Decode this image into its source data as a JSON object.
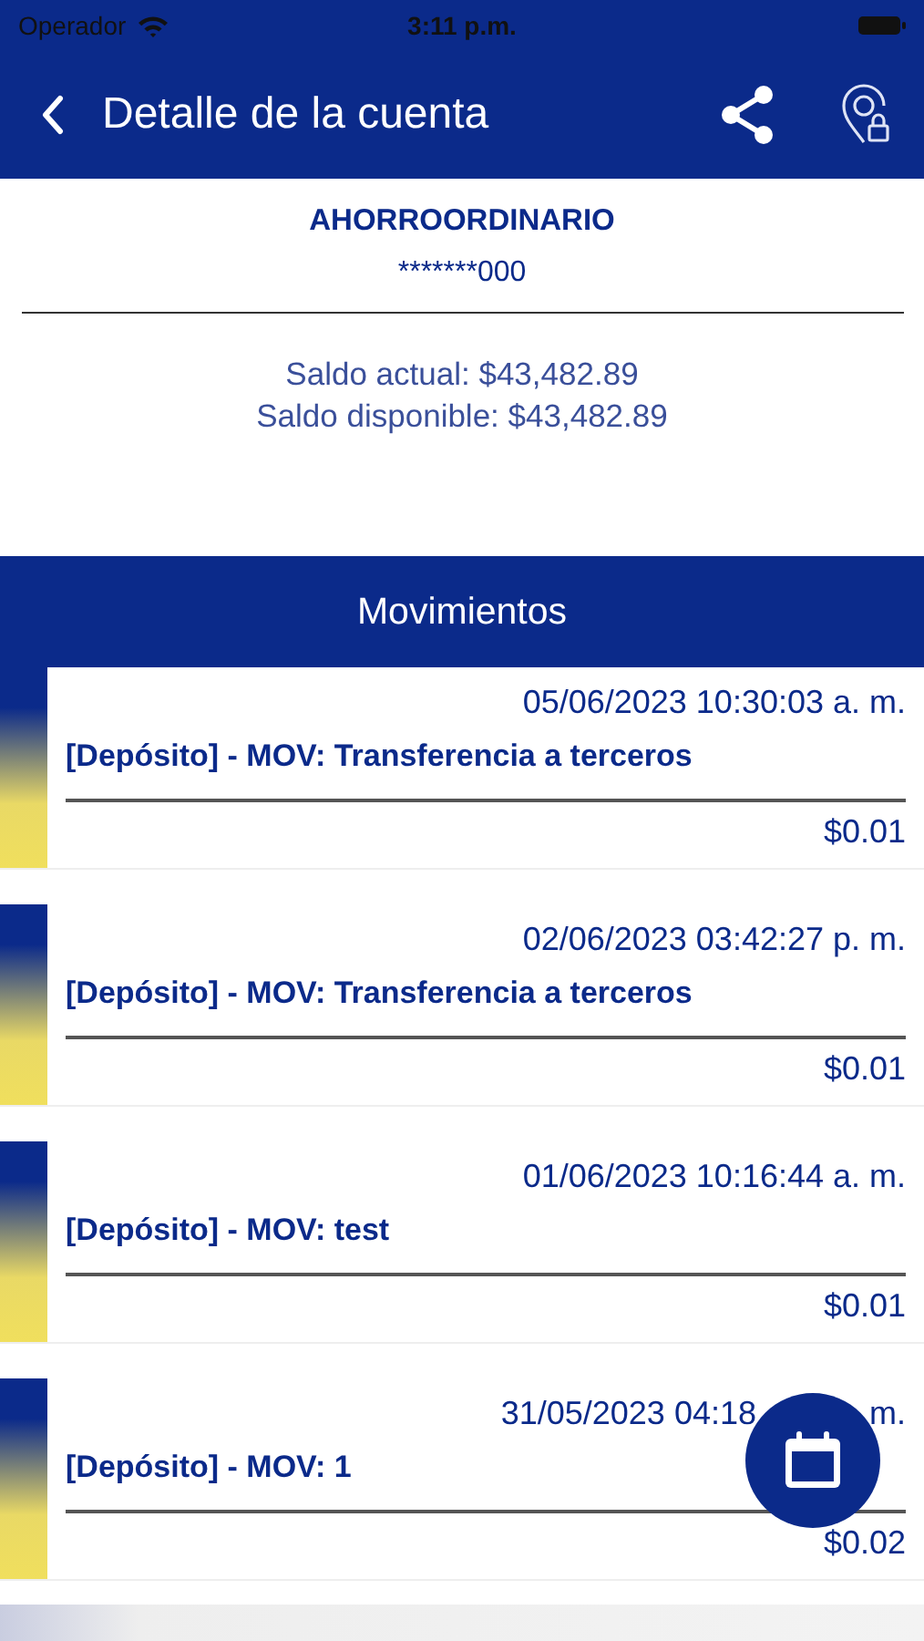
{
  "status_bar": {
    "carrier": "Operador",
    "time": "3:11 p.m."
  },
  "header": {
    "title": "Detalle de la cuenta"
  },
  "account": {
    "name": "AHORROORDINARIO",
    "number": "*******000",
    "balances": [
      "Saldo actual: $43,482.89",
      "Saldo disponible: $43,482.89"
    ]
  },
  "movements": {
    "title": "Movimientos",
    "items": [
      {
        "date": "05/06/2023 10:30:03 a. m.",
        "description": "[Depósito] - MOV: Transferencia a terceros",
        "amount": "$0.01"
      },
      {
        "date": "02/06/2023 03:42:27 p. m.",
        "description": "[Depósito] - MOV: Transferencia a terceros",
        "amount": "$0.01"
      },
      {
        "date": "01/06/2023 10:16:44 a. m.",
        "description": "[Depósito] - MOV: test",
        "amount": "$0.01"
      },
      {
        "date": "31/05/2023 04:18",
        "date_end": "m.",
        "description": "[Depósito] - MOV: 1",
        "amount": "$0.02"
      }
    ]
  }
}
